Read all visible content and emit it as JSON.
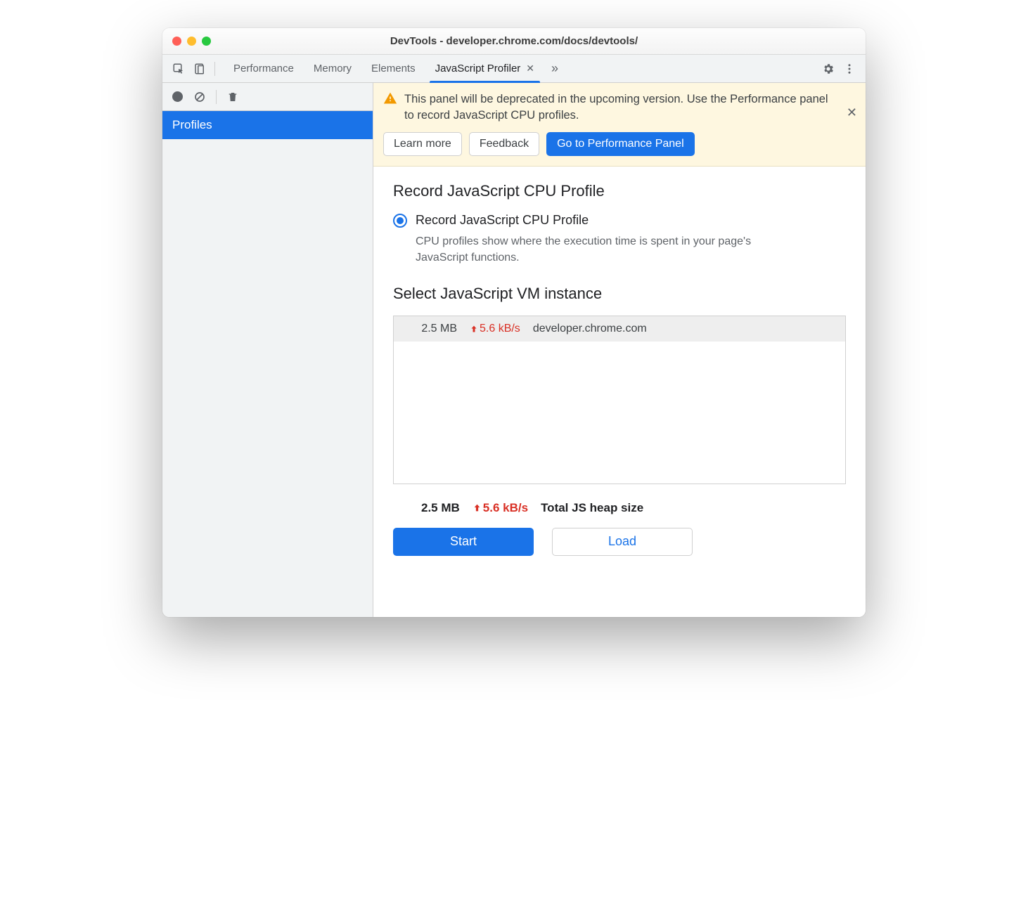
{
  "title": "DevTools - developer.chrome.com/docs/devtools/",
  "tabs": {
    "performance": "Performance",
    "memory": "Memory",
    "elements": "Elements",
    "profiler": "JavaScript Profiler"
  },
  "sidebar": {
    "profiles": "Profiles"
  },
  "banner": {
    "text": "This panel will be deprecated in the upcoming version. Use the Performance panel to record JavaScript CPU profiles.",
    "learn_more": "Learn more",
    "feedback": "Feedback",
    "go_panel": "Go to Performance Panel"
  },
  "record": {
    "heading": "Record JavaScript CPU Profile",
    "option_label": "Record JavaScript CPU Profile",
    "option_desc": "CPU profiles show where the execution time is spent in your page's JavaScript functions."
  },
  "vm": {
    "heading": "Select JavaScript VM instance",
    "row": {
      "size": "2.5 MB",
      "rate": "5.6 kB/s",
      "host": "developer.chrome.com"
    }
  },
  "total": {
    "size": "2.5 MB",
    "rate": "5.6 kB/s",
    "label": "Total JS heap size"
  },
  "actions": {
    "start": "Start",
    "load": "Load"
  }
}
